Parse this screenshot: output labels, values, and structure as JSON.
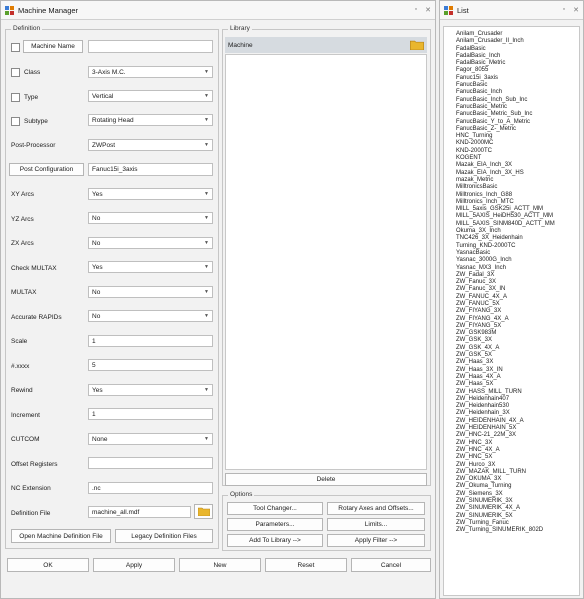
{
  "window": {
    "title": "Machine Manager",
    "controls": [
      "▫",
      "✕"
    ]
  },
  "definition": {
    "group_label": "Definition",
    "machine_name_button": "Machine Name",
    "machine_name_value": "",
    "class_label": "Class",
    "class_value": "3-Axis M.C.",
    "type_label": "Type",
    "type_value": "Vertical",
    "subtype_label": "Subtype",
    "subtype_value": "Rotating Head",
    "post_processor_label": "Post-Processor",
    "post_processor_value": "ZWPost",
    "post_config_button": "Post Configuration",
    "post_config_value": "Fanuc15i_3axis",
    "xy_arcs_label": "XY Arcs",
    "xy_arcs_value": "Yes",
    "yz_arcs_label": "YZ Arcs",
    "yz_arcs_value": "No",
    "zx_arcs_label": "ZX Arcs",
    "zx_arcs_value": "No",
    "check_multax_label": "Check MULTAX",
    "check_multax_value": "Yes",
    "multax_label": "MULTAX",
    "multax_value": "No",
    "accurate_rapids_label": "Accurate RAPIDs",
    "accurate_rapids_value": "No",
    "scale_label": "Scale",
    "scale_value": "1",
    "xxxx_label": "#.xxxx",
    "xxxx_value": "5",
    "rewind_label": "Rewind",
    "rewind_value": "Yes",
    "increment_label": "Increment",
    "increment_value": "1",
    "cutcom_label": "CUTCOM",
    "cutcom_value": "None",
    "offset_label": "Offset Registers",
    "offset_value": "",
    "nc_ext_label": "NC Extension",
    "nc_ext_value": ".nc",
    "def_file_label": "Definition File",
    "def_file_value": "machine_all.mdf",
    "open_def_button": "Open Machine Definition File",
    "legacy_button": "Legacy Definition Files"
  },
  "library": {
    "group_label": "Library",
    "header": "Machine",
    "delete_button": "Delete"
  },
  "options": {
    "group_label": "Options",
    "tool_changer": "Tool Changer...",
    "rotary_axes": "Rotary Axes and Offsets...",
    "parameters": "Parameters...",
    "limits": "Limits...",
    "add_to_library": "Add To Library -->",
    "apply_filter": "Apply Filter -->"
  },
  "bottom": {
    "ok": "OK",
    "apply": "Apply",
    "new": "New",
    "reset": "Reset",
    "cancel": "Cancel"
  },
  "list": {
    "title": "List",
    "controls": [
      "▫",
      "✕"
    ],
    "items": [
      "Anilam_Crusader",
      "Anilam_Crusader_II_Inch",
      "FadalBasic",
      "FadalBasic_Inch",
      "FadalBasic_Metric",
      "Fagor_8055",
      "Fanuc15i_3axis",
      "FanucBasic",
      "FanucBasic_Inch",
      "FanucBasic_Inch_Sub_Inc",
      "FanucBasic_Metric",
      "FanucBasic_Metric_Sub_Inc",
      "FanucBasic_Y_to_A_Metric",
      "FanucBasic_Z-_Metric",
      "HNC_Turning",
      "KND-2000MC",
      "KND-2000TC",
      "KOGENT",
      "Mazak_EIA_Inch_3X",
      "Mazak_EIA_Inch_3X_HS",
      "mazak_Metric",
      "MilltronicsBasic",
      "Milltronics_Inch_G88",
      "Milltronics_Inch_MTC",
      "MILL_5axis_GSK25i_ACTT_MM",
      "MILL_5AXIS_HeiDH530_ACTT_MM",
      "MILL_5AXIS_SINM840D_ACTT_MM",
      "Okuma_3X_Inch",
      "TNC426_3X_Heidenhain",
      "Turning_KND-2000TC",
      "YasnacBasic",
      "Yasnac_3000G_Inch",
      "Yasnac_MX3_Inch",
      "ZW_Fadal_3X",
      "ZW_Fanuc_3X",
      "ZW_Fanuc_3X_IN",
      "ZW_FANUC_4X_A",
      "ZW_FANUC_5X",
      "ZW_FIYANG_3X",
      "ZW_FIYANG_4X_A",
      "ZW_FIYANG_5X",
      "ZW_GSK983M",
      "ZW_GSK_3X",
      "ZW_GSK_4X_A",
      "ZW_GSK_5X",
      "ZW_Haas_3X",
      "ZW_Haas_3X_IN",
      "ZW_Haas_4X_A",
      "ZW_Haas_5X",
      "ZW_HASS_MILL_TURN",
      "ZW_Heidenhain407",
      "ZW_Heidenhain530",
      "ZW_Heidenhain_3X",
      "ZW_HEIDENHAIN_4X_A",
      "ZW_HEIDENHAIN_5X",
      "ZW_HNC-21_22M_3X",
      "ZW_HNC_3X",
      "ZW_HNC_4X_A",
      "ZW_HNC_5X",
      "ZW_Hurco_3X",
      "ZW_MAZAK_MILL_TURN",
      "ZW_OKUMA_3X",
      "ZW_Okuma_Turning",
      "ZW_Siemens_3X",
      "ZW_SINUMERIK_3X",
      "ZW_SINUMERIK_4X_A",
      "ZW_SINUMERIK_5X",
      "ZW_Turning_Fanuc",
      "ZW_Turning_SINUMERIK_802D"
    ]
  }
}
